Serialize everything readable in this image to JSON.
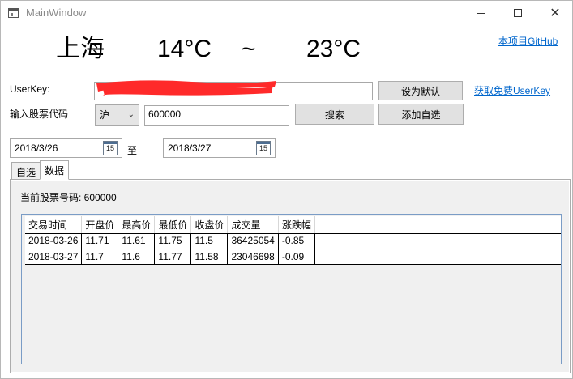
{
  "window": {
    "title": "MainWindow"
  },
  "weather": {
    "city": "上海",
    "low": "14°C",
    "separator": "~",
    "high": "23°C"
  },
  "links": {
    "github": "本项目GitHub",
    "get_userkey": "获取免费UserKey"
  },
  "userkey": {
    "label": "UserKey:",
    "value": "",
    "set_default_button": "设为默认"
  },
  "stock_input": {
    "label": "输入股票代码",
    "market": "沪",
    "code": "600000",
    "search_button": "搜索",
    "add_favorite_button": "添加自选"
  },
  "dates": {
    "start": "2018/3/26",
    "to_label": "至",
    "end": "2018/3/27",
    "calendar_glyph": "15"
  },
  "tabs": [
    {
      "label": "自选"
    },
    {
      "label": "数据"
    }
  ],
  "data_tab": {
    "current_stock_label": "当前股票号码: 600000",
    "columns": [
      "交易时间",
      "开盘价",
      "最高价",
      "最低价",
      "收盘价",
      "成交量",
      "涨跌幅"
    ],
    "rows": [
      [
        "2018-03-26",
        "11.71",
        "11.61",
        "11.75",
        "11.5",
        "36425054",
        "-0.85"
      ],
      [
        "2018-03-27",
        "11.7",
        "11.6",
        "11.77",
        "11.58",
        "23046698",
        "-0.09"
      ]
    ]
  },
  "colors": {
    "link": "#0066cc",
    "redaction": "#ff2a2a",
    "grid_border": "#7a9cc6"
  }
}
